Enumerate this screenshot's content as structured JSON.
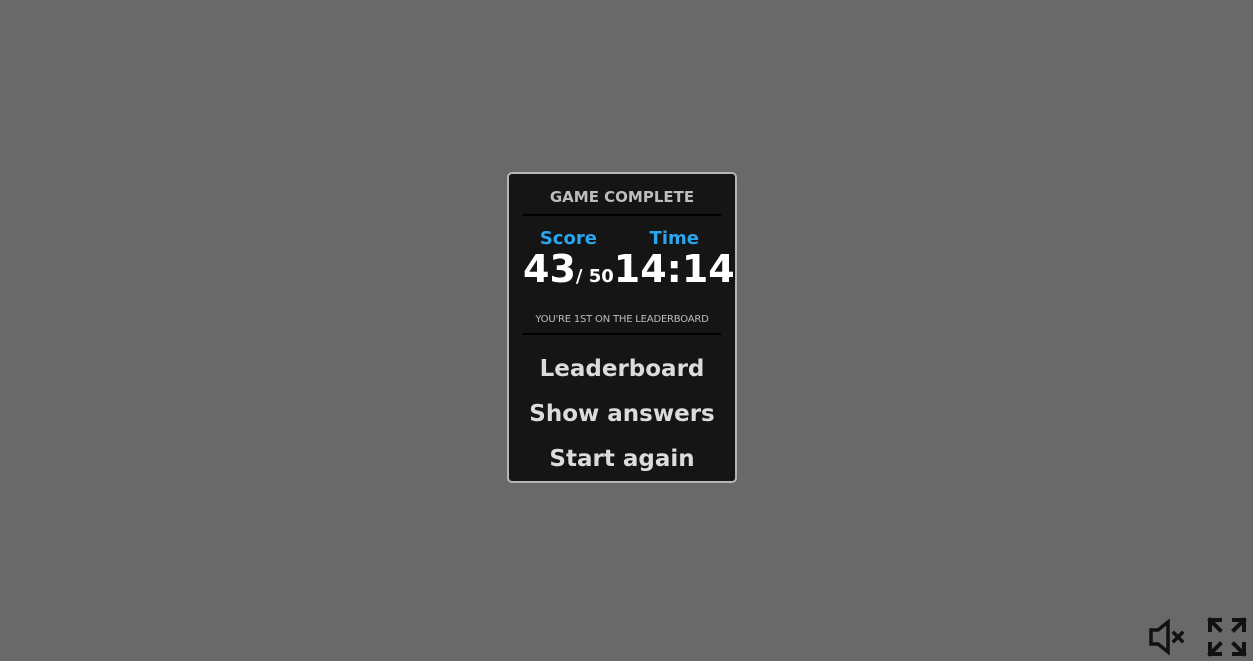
{
  "panel": {
    "title": "GAME COMPLETE",
    "score": {
      "label": "Score",
      "value": "43",
      "total": "/ 50"
    },
    "time": {
      "label": "Time",
      "value": "14:14"
    },
    "rank_message": "YOU'RE 1ST ON THE LEADERBOARD"
  },
  "menu": {
    "leaderboard_label": "Leaderboard",
    "show_answers_label": "Show answers",
    "start_again_label": "Start again"
  },
  "controls": {
    "mute_icon": "speaker-muted-icon",
    "fullscreen_icon": "fullscreen-expand-icon"
  },
  "colors": {
    "background": "#696969",
    "panel": "#151515",
    "accent": "#2aa5f0",
    "text": "#dcdcdc"
  }
}
